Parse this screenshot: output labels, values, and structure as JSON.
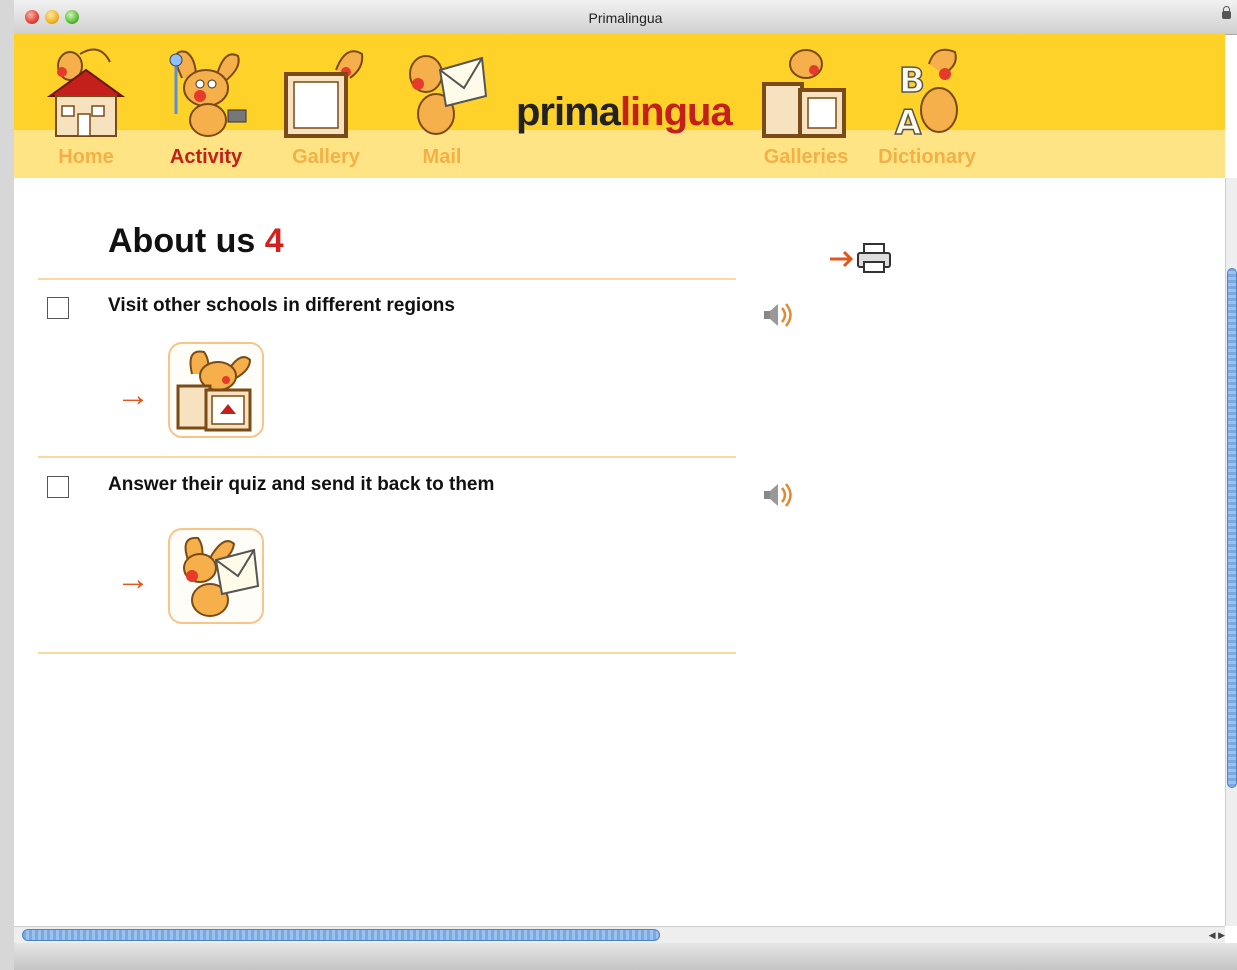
{
  "window": {
    "title": "Primalingua"
  },
  "nav": {
    "items": [
      {
        "label": "Home"
      },
      {
        "label": "Activity"
      },
      {
        "label": "Gallery"
      },
      {
        "label": "Mail"
      },
      {
        "label": "Galleries"
      },
      {
        "label": "Dictionary"
      }
    ],
    "logo": {
      "part1": "prima",
      "part2": "lingua"
    }
  },
  "page": {
    "title": "About us",
    "title_number": "4",
    "tasks": [
      {
        "text": "Visit other schools in different regions",
        "icon": "gallery-icon"
      },
      {
        "text": "Answer their quiz and send it back to them",
        "icon": "mail-icon"
      }
    ]
  },
  "colors": {
    "header": "#ffd22a",
    "accent_red": "#c3201b",
    "arrow": "#e0561c"
  }
}
